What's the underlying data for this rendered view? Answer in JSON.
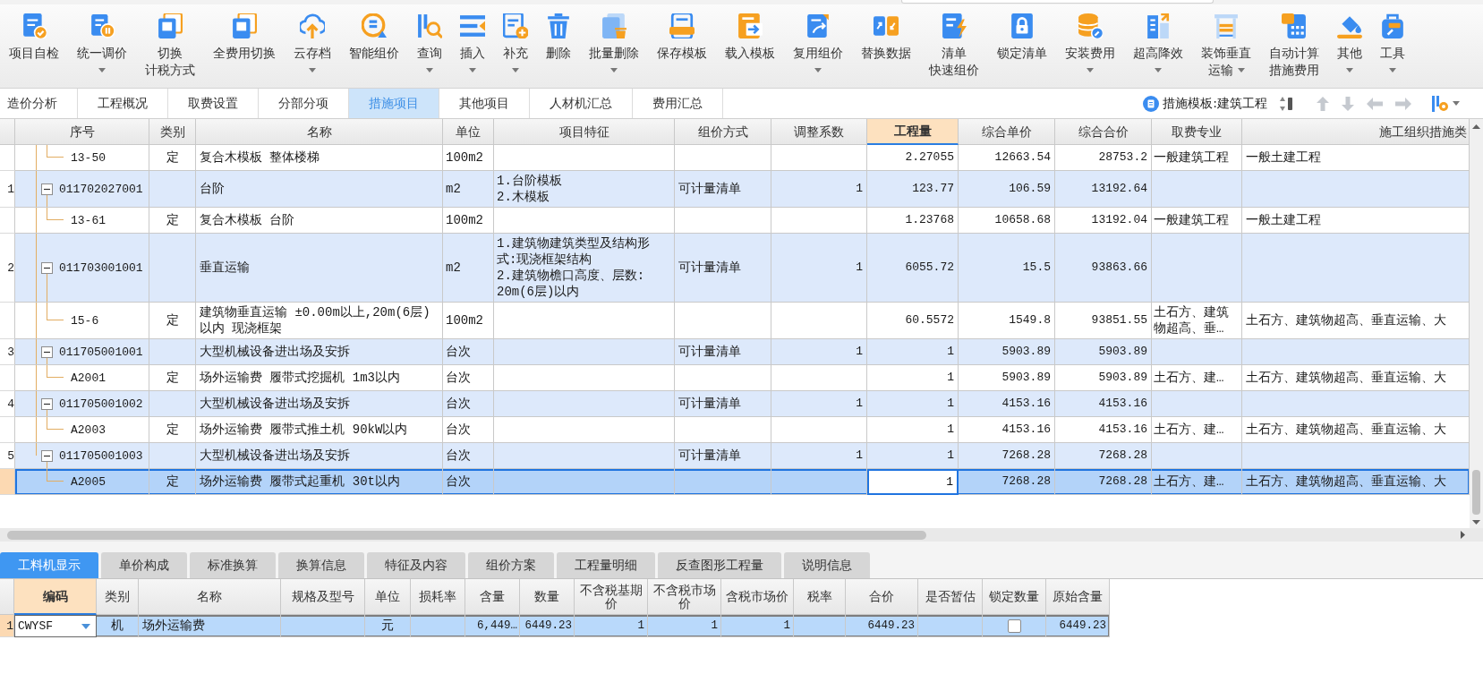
{
  "toolbar": {
    "buttons": [
      {
        "lines": [
          "项目自检"
        ],
        "dropdown": false
      },
      {
        "lines": [
          "统一调价"
        ],
        "dropdown": true
      },
      {
        "lines": [
          "切换",
          "计税方式"
        ],
        "dropdown": false
      },
      {
        "lines": [
          "全费用切换"
        ],
        "dropdown": false
      },
      {
        "lines": [
          "云存档"
        ],
        "dropdown": true
      },
      {
        "lines": [
          "智能组价"
        ],
        "dropdown": false
      },
      {
        "lines": [
          "查询"
        ],
        "dropdown": true
      },
      {
        "lines": [
          "插入"
        ],
        "dropdown": true
      },
      {
        "lines": [
          "补充"
        ],
        "dropdown": true
      },
      {
        "lines": [
          "删除"
        ],
        "dropdown": false
      },
      {
        "lines": [
          "批量删除"
        ],
        "dropdown": true
      },
      {
        "lines": [
          "保存模板"
        ],
        "dropdown": false
      },
      {
        "lines": [
          "载入模板"
        ],
        "dropdown": false
      },
      {
        "lines": [
          "复用组价"
        ],
        "dropdown": true
      },
      {
        "lines": [
          "替换数据"
        ],
        "dropdown": false
      },
      {
        "lines": [
          "清单",
          "快速组价"
        ],
        "dropdown": false
      },
      {
        "lines": [
          "锁定清单"
        ],
        "dropdown": false
      },
      {
        "lines": [
          "安装费用"
        ],
        "dropdown": true
      },
      {
        "lines": [
          "超高降效"
        ],
        "dropdown": true
      },
      {
        "lines": [
          "装饰垂直",
          "运输"
        ],
        "dropdown": true
      },
      {
        "lines": [
          "自动计算",
          "措施费用"
        ],
        "dropdown": false
      },
      {
        "lines": [
          "其他"
        ],
        "dropdown": true
      },
      {
        "lines": [
          "工具"
        ],
        "dropdown": true
      }
    ]
  },
  "tabs": [
    {
      "label": "造价分析",
      "selected": false
    },
    {
      "label": "工程概况",
      "selected": false
    },
    {
      "label": "取费设置",
      "selected": false
    },
    {
      "label": "分部分项",
      "selected": false
    },
    {
      "label": "措施项目",
      "selected": true
    },
    {
      "label": "其他项目",
      "selected": false
    },
    {
      "label": "人材机汇总",
      "selected": false
    },
    {
      "label": "费用汇总",
      "selected": false
    }
  ],
  "template": {
    "label": "措施模板:建筑工程"
  },
  "table": {
    "columns": [
      {
        "label": "序号",
        "selected": false
      },
      {
        "label": "类别",
        "selected": false
      },
      {
        "label": "名称",
        "selected": false
      },
      {
        "label": "单位",
        "selected": false
      },
      {
        "label": "项目特征",
        "selected": false
      },
      {
        "label": "组价方式",
        "selected": false
      },
      {
        "label": "调整系数",
        "selected": false
      },
      {
        "label": "工程量",
        "selected": true
      },
      {
        "label": "综合单价",
        "selected": false
      },
      {
        "label": "综合合价",
        "selected": false
      },
      {
        "label": "取费专业",
        "selected": false
      },
      {
        "label": "施工组织措施类",
        "selected": false
      }
    ],
    "rows": [
      {
        "kind": "quota",
        "code": "13-50",
        "type": "定",
        "name": "复合木模板 整体楼梯",
        "unit": "100m2",
        "quantity": "2.27055",
        "unit_price": "12663.54",
        "total": "28753.2",
        "fee_category": "一般建筑工程",
        "measure_category": "一般土建工程",
        "selected": false
      },
      {
        "kind": "list",
        "number": "1",
        "expanded": true,
        "code": "011702027001",
        "name": "台阶",
        "unit": "m2",
        "feature": "1.台阶模板\n2.木模板",
        "pricing": "可计量清单",
        "coefficient": "1",
        "quantity": "123.77",
        "unit_price": "106.59",
        "total": "13192.64",
        "selected": false,
        "children": [
          {
            "kind": "quota",
            "code": "13-61",
            "type": "定",
            "name": "复合木模板 台阶",
            "unit": "100m2",
            "quantity": "1.23768",
            "unit_price": "10658.68",
            "total": "13192.04",
            "fee_category": "一般建筑工程",
            "measure_category": "一般土建工程",
            "selected": false
          }
        ]
      },
      {
        "kind": "list",
        "number": "2",
        "expanded": true,
        "code": "011703001001",
        "name": "垂直运输",
        "unit": "m2",
        "feature": "1.建筑物建筑类型及结构形式:现浇框架结构\n2.建筑物檐口高度、层数:20m(6层)以内",
        "pricing": "可计量清单",
        "coefficient": "1",
        "quantity": "6055.72",
        "unit_price": "15.5",
        "total": "93863.66",
        "selected": false,
        "children": [
          {
            "kind": "quota",
            "code": "15-6",
            "type": "定",
            "name": "建筑物垂直运输 ±0.00m以上,20m(6层)以内 现浇框架",
            "unit": "100m2",
            "quantity": "60.5572",
            "unit_price": "1549.8",
            "total": "93851.55",
            "fee_category": "土石方、建筑物超高、垂…",
            "measure_category": "土石方、建筑物超高、垂直运输、大",
            "selected": false
          }
        ]
      },
      {
        "kind": "list",
        "number": "3",
        "expanded": true,
        "code": "011705001001",
        "name": "大型机械设备进出场及安拆",
        "unit": "台次",
        "pricing": "可计量清单",
        "coefficient": "1",
        "quantity": "1",
        "unit_price": "5903.89",
        "total": "5903.89",
        "selected": false,
        "children": [
          {
            "kind": "quota",
            "code": "A2001",
            "type": "定",
            "name": "场外运输费 履带式挖掘机 1m3以内",
            "unit": "台次",
            "quantity": "1",
            "unit_price": "5903.89",
            "total": "5903.89",
            "fee_category": "土石方、建…",
            "measure_category": "土石方、建筑物超高、垂直运输、大",
            "selected": false
          }
        ]
      },
      {
        "kind": "list",
        "number": "4",
        "expanded": true,
        "code": "011705001002",
        "name": "大型机械设备进出场及安拆",
        "unit": "台次",
        "pricing": "可计量清单",
        "coefficient": "1",
        "quantity": "1",
        "unit_price": "4153.16",
        "total": "4153.16",
        "selected": false,
        "children": [
          {
            "kind": "quota",
            "code": "A2003",
            "type": "定",
            "name": "场外运输费 履带式推土机 90kW以内",
            "unit": "台次",
            "quantity": "1",
            "unit_price": "4153.16",
            "total": "4153.16",
            "fee_category": "土石方、建…",
            "measure_category": "土石方、建筑物超高、垂直运输、大",
            "selected": false
          }
        ]
      },
      {
        "kind": "list",
        "number": "5",
        "expanded": true,
        "code": "011705001003",
        "name": "大型机械设备进出场及安拆",
        "unit": "台次",
        "pricing": "可计量清单",
        "coefficient": "1",
        "quantity": "1",
        "unit_price": "7268.28",
        "total": "7268.28",
        "selected": false,
        "children": [
          {
            "kind": "quota",
            "code": "A2005",
            "type": "定",
            "name": "场外运输费 履带式起重机 30t以内",
            "unit": "台次",
            "quantity": "1",
            "unit_price": "7268.28",
            "total": "7268.28",
            "fee_category": "土石方、建…",
            "measure_category": "土石方、建筑物超高、垂直运输、大",
            "selected": true
          }
        ]
      }
    ]
  },
  "bottom_tabs": [
    {
      "label": "工料机显示",
      "selected": true
    },
    {
      "label": "单价构成",
      "selected": false
    },
    {
      "label": "标准换算",
      "selected": false
    },
    {
      "label": "换算信息",
      "selected": false
    },
    {
      "label": "特征及内容",
      "selected": false
    },
    {
      "label": "组价方案",
      "selected": false
    },
    {
      "label": "工程量明细",
      "selected": false
    },
    {
      "label": "反查图形工程量",
      "selected": false
    },
    {
      "label": "说明信息",
      "selected": false
    }
  ],
  "resource_table": {
    "columns": [
      {
        "label": "编码",
        "selected": true
      },
      {
        "label": "类别",
        "selected": false
      },
      {
        "label": "名称",
        "selected": false
      },
      {
        "label": "规格及型号",
        "selected": false
      },
      {
        "label": "单位",
        "selected": false
      },
      {
        "label": "损耗率",
        "selected": false
      },
      {
        "label": "含量",
        "selected": false
      },
      {
        "label": "数量",
        "selected": false
      },
      {
        "label": "不含税基期价",
        "selected": false
      },
      {
        "label": "不含税市场价",
        "selected": false
      },
      {
        "label": "含税市场价",
        "selected": false
      },
      {
        "label": "税率",
        "selected": false
      },
      {
        "label": "合价",
        "selected": false
      },
      {
        "label": "是否暂估",
        "selected": false
      },
      {
        "label": "锁定数量",
        "selected": false
      },
      {
        "label": "原始含量",
        "selected": false
      }
    ],
    "rows": [
      {
        "number": "1",
        "code": "CWYSF",
        "type": "机",
        "name": "场外运输费",
        "unit": "元",
        "content": "6,449…",
        "quantity": "6449.23",
        "base_price_excl_tax": "1",
        "market_price_excl_tax": "1",
        "market_price_incl_tax": "1",
        "total": "6449.23",
        "locked": false,
        "original_content": "6449.23",
        "selected": true
      }
    ]
  }
}
